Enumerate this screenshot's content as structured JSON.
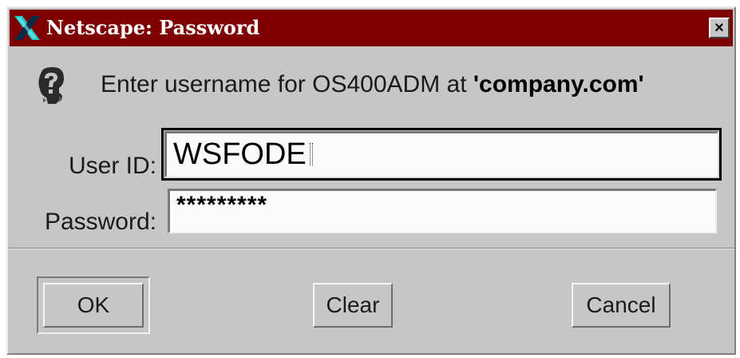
{
  "window": {
    "title": "Netscape: Password",
    "close_glyph": "×"
  },
  "dialog": {
    "prompt_prefix": "Enter username for OS400ADM at ",
    "prompt_host": "'company.com'",
    "user_label": "User ID:",
    "user_value": "WSFODE",
    "password_label": "Password:",
    "password_value": "*********"
  },
  "buttons": {
    "ok": "OK",
    "clear": "Clear",
    "cancel": "Cancel"
  },
  "colors": {
    "titlebar": "#7e0000",
    "dialog_bg": "#c6c6c6",
    "icon_accent": "#22c7c7"
  },
  "icons": {
    "app": "netscape-x-icon",
    "prompt": "question-head-icon",
    "close": "close-icon"
  }
}
